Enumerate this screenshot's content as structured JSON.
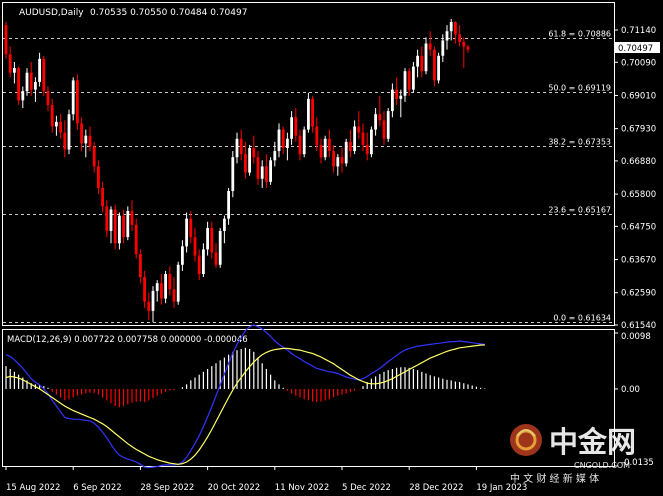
{
  "header": {
    "symbol": "AUDUSD,Daily",
    "ohlc": "0.70535 0.70550 0.70484 0.70497"
  },
  "current_price_label": "0.70497",
  "indicator": {
    "label": "MACD(12,26,9) 0.007722 0.007758 0.000000 -0.000046",
    "axis_ticks": [
      "0.0098",
      "0.00",
      "-0.0135"
    ]
  },
  "watermark": {
    "name": "中金网",
    "domain": "CNGOLD.COM",
    "slogan": "中 文 财 经 新 媒 体"
  },
  "colors": {
    "bull": "#ffffff",
    "bear": "#ff0000",
    "macd_main": "#3333ff",
    "macd_signal": "#ffff66",
    "grid_dash": "#c8c8c8"
  },
  "chart_data": {
    "type": "candlestick",
    "price_axis_ticks": [
      "0.71140",
      "0.70090",
      "0.69010",
      "0.67930",
      "0.66880",
      "0.65800",
      "0.64750",
      "0.63670",
      "0.62590",
      "0.61540"
    ],
    "price_axis_values": [
      0.7114,
      0.7009,
      0.6901,
      0.6793,
      0.6688,
      0.658,
      0.6475,
      0.6367,
      0.6259,
      0.6154
    ],
    "fib_levels": [
      {
        "label": "61.8 = 0.70886",
        "value": 0.70886
      },
      {
        "label": "50.0 = 0.69119",
        "value": 0.69119
      },
      {
        "label": "38.2 = 0.67353",
        "value": 0.67353
      },
      {
        "label": "23.6 = 0.65167",
        "value": 0.65167
      },
      {
        "label": "0.0 = 0.61634",
        "value": 0.61634
      }
    ],
    "x_labels": [
      "15 Aug 2022",
      "6 Sep 2022",
      "28 Sep 2022",
      "20 Oct 2022",
      "11 Nov 2022",
      "5 Dec 2022",
      "28 Dec 2022",
      "19 Jan 2023"
    ],
    "x_label_index": [
      0,
      16,
      32,
      48,
      64,
      80,
      96,
      112
    ],
    "candles": [
      [
        0.713,
        0.714,
        0.702,
        0.7035
      ],
      [
        0.7035,
        0.706,
        0.696,
        0.6975
      ],
      [
        0.6975,
        0.701,
        0.694,
        0.699
      ],
      [
        0.699,
        0.6995,
        0.687,
        0.6885
      ],
      [
        0.6885,
        0.693,
        0.686,
        0.6915
      ],
      [
        0.6915,
        0.699,
        0.69,
        0.6975
      ],
      [
        0.6975,
        0.701,
        0.69,
        0.692
      ],
      [
        0.692,
        0.696,
        0.688,
        0.6945
      ],
      [
        0.6945,
        0.704,
        0.693,
        0.702
      ],
      [
        0.702,
        0.703,
        0.69,
        0.6915
      ],
      [
        0.6915,
        0.693,
        0.685,
        0.687
      ],
      [
        0.687,
        0.689,
        0.678,
        0.68
      ],
      [
        0.68,
        0.6835,
        0.677,
        0.6815
      ],
      [
        0.6815,
        0.684,
        0.676,
        0.678
      ],
      [
        0.678,
        0.682,
        0.67,
        0.6725
      ],
      [
        0.6725,
        0.6855,
        0.671,
        0.684
      ],
      [
        0.684,
        0.696,
        0.682,
        0.695
      ],
      [
        0.695,
        0.697,
        0.679,
        0.681
      ],
      [
        0.681,
        0.683,
        0.672,
        0.6745
      ],
      [
        0.6745,
        0.679,
        0.67,
        0.677
      ],
      [
        0.677,
        0.68,
        0.672,
        0.6735
      ],
      [
        0.6735,
        0.675,
        0.665,
        0.667
      ],
      [
        0.667,
        0.669,
        0.658,
        0.66
      ],
      [
        0.66,
        0.662,
        0.652,
        0.654
      ],
      [
        0.654,
        0.656,
        0.644,
        0.646
      ],
      [
        0.646,
        0.654,
        0.642,
        0.653
      ],
      [
        0.653,
        0.6545,
        0.64,
        0.642
      ],
      [
        0.642,
        0.652,
        0.64,
        0.651
      ],
      [
        0.651,
        0.653,
        0.642,
        0.644
      ],
      [
        0.644,
        0.654,
        0.643,
        0.6525
      ],
      [
        0.6525,
        0.656,
        0.646,
        0.648
      ],
      [
        0.648,
        0.65,
        0.637,
        0.6385
      ],
      [
        0.6385,
        0.64,
        0.629,
        0.631
      ],
      [
        0.631,
        0.633,
        0.621,
        0.623
      ],
      [
        0.623,
        0.626,
        0.617,
        0.62
      ],
      [
        0.62,
        0.628,
        0.6163,
        0.6265
      ],
      [
        0.6265,
        0.63,
        0.623,
        0.629
      ],
      [
        0.629,
        0.632,
        0.622,
        0.624
      ],
      [
        0.624,
        0.633,
        0.6225,
        0.632
      ],
      [
        0.632,
        0.6345,
        0.625,
        0.627
      ],
      [
        0.627,
        0.631,
        0.621,
        0.623
      ],
      [
        0.623,
        0.636,
        0.622,
        0.635
      ],
      [
        0.635,
        0.643,
        0.633,
        0.641
      ],
      [
        0.641,
        0.652,
        0.639,
        0.65
      ],
      [
        0.65,
        0.6525,
        0.642,
        0.644
      ],
      [
        0.644,
        0.647,
        0.636,
        0.638
      ],
      [
        0.638,
        0.64,
        0.63,
        0.632
      ],
      [
        0.632,
        0.642,
        0.631,
        0.64
      ],
      [
        0.64,
        0.649,
        0.638,
        0.647
      ],
      [
        0.647,
        0.649,
        0.637,
        0.639
      ],
      [
        0.639,
        0.642,
        0.634,
        0.635
      ],
      [
        0.635,
        0.647,
        0.634,
        0.646
      ],
      [
        0.646,
        0.651,
        0.642,
        0.65
      ],
      [
        0.65,
        0.66,
        0.648,
        0.659
      ],
      [
        0.659,
        0.672,
        0.657,
        0.67
      ],
      [
        0.67,
        0.678,
        0.668,
        0.676
      ],
      [
        0.676,
        0.679,
        0.669,
        0.671
      ],
      [
        0.671,
        0.675,
        0.663,
        0.665
      ],
      [
        0.665,
        0.674,
        0.664,
        0.673
      ],
      [
        0.673,
        0.677,
        0.668,
        0.67
      ],
      [
        0.67,
        0.672,
        0.661,
        0.663
      ],
      [
        0.663,
        0.669,
        0.66,
        0.667
      ],
      [
        0.667,
        0.671,
        0.66,
        0.662
      ],
      [
        0.662,
        0.67,
        0.661,
        0.669
      ],
      [
        0.669,
        0.675,
        0.667,
        0.672
      ],
      [
        0.672,
        0.681,
        0.67,
        0.679
      ],
      [
        0.679,
        0.68,
        0.671,
        0.673
      ],
      [
        0.673,
        0.678,
        0.669,
        0.676
      ],
      [
        0.676,
        0.685,
        0.674,
        0.683
      ],
      [
        0.683,
        0.686,
        0.675,
        0.677
      ],
      [
        0.677,
        0.679,
        0.669,
        0.671
      ],
      [
        0.671,
        0.68,
        0.67,
        0.679
      ],
      [
        0.679,
        0.691,
        0.678,
        0.689
      ],
      [
        0.689,
        0.69,
        0.678,
        0.68
      ],
      [
        0.68,
        0.683,
        0.672,
        0.674
      ],
      [
        0.674,
        0.676,
        0.668,
        0.67
      ],
      [
        0.67,
        0.677,
        0.669,
        0.676
      ],
      [
        0.676,
        0.679,
        0.67,
        0.672
      ],
      [
        0.672,
        0.674,
        0.665,
        0.667
      ],
      [
        0.667,
        0.671,
        0.664,
        0.67
      ],
      [
        0.67,
        0.673,
        0.665,
        0.668
      ],
      [
        0.668,
        0.676,
        0.667,
        0.675
      ],
      [
        0.675,
        0.679,
        0.67,
        0.672
      ],
      [
        0.672,
        0.682,
        0.671,
        0.68
      ],
      [
        0.68,
        0.685,
        0.676,
        0.678
      ],
      [
        0.678,
        0.681,
        0.672,
        0.674
      ],
      [
        0.674,
        0.678,
        0.669,
        0.671
      ],
      [
        0.671,
        0.68,
        0.67,
        0.679
      ],
      [
        0.679,
        0.686,
        0.677,
        0.684
      ],
      [
        0.684,
        0.69,
        0.68,
        0.682
      ],
      [
        0.682,
        0.685,
        0.674,
        0.676
      ],
      [
        0.676,
        0.686,
        0.675,
        0.685
      ],
      [
        0.685,
        0.694,
        0.683,
        0.692
      ],
      [
        0.692,
        0.696,
        0.687,
        0.689
      ],
      [
        0.689,
        0.692,
        0.683,
        0.69
      ],
      [
        0.69,
        0.699,
        0.688,
        0.698
      ],
      [
        0.698,
        0.699,
        0.69,
        0.692
      ],
      [
        0.692,
        0.701,
        0.691,
        0.6995
      ],
      [
        0.6995,
        0.705,
        0.696,
        0.703
      ],
      [
        0.703,
        0.706,
        0.696,
        0.698
      ],
      [
        0.698,
        0.709,
        0.697,
        0.707
      ],
      [
        0.707,
        0.711,
        0.703,
        0.705
      ],
      [
        0.705,
        0.706,
        0.693,
        0.695
      ],
      [
        0.695,
        0.704,
        0.694,
        0.703
      ],
      [
        0.703,
        0.71,
        0.701,
        0.708
      ],
      [
        0.708,
        0.713,
        0.705,
        0.711
      ],
      [
        0.711,
        0.715,
        0.708,
        0.714
      ],
      [
        0.714,
        0.7142,
        0.707,
        0.71
      ],
      [
        0.71,
        0.713,
        0.706,
        0.7075
      ],
      [
        0.7075,
        0.709,
        0.699,
        0.706
      ],
      [
        0.706,
        0.7065,
        0.704,
        0.705
      ]
    ],
    "macd": {
      "ylim": [
        -0.0135,
        0.0098
      ],
      "histogram": [
        0.004,
        0.0035,
        0.003,
        0.0025,
        0.002,
        0.0015,
        0.001,
        0.0008,
        0.0007,
        0.0005,
        0.0002,
        -0.0005,
        -0.001,
        -0.0015,
        -0.002,
        -0.0018,
        -0.0015,
        -0.0012,
        -0.001,
        -0.0008,
        -0.0006,
        -0.0007,
        -0.001,
        -0.0015,
        -0.002,
        -0.0025,
        -0.003,
        -0.0032,
        -0.003,
        -0.0027,
        -0.0024,
        -0.0022,
        -0.0022,
        -0.0023,
        -0.002,
        -0.0016,
        -0.0012,
        -0.0008,
        -0.0005,
        -0.0003,
        -0.0002,
        0.0,
        0.0003,
        0.0008,
        0.0015,
        0.002,
        0.0025,
        0.003,
        0.0035,
        0.004,
        0.0045,
        0.005,
        0.0055,
        0.006,
        0.0065,
        0.0068,
        0.007,
        0.0072,
        0.007,
        0.0065,
        0.0055,
        0.0045,
        0.0035,
        0.0025,
        0.0015,
        0.0008,
        0.0002,
        -0.0003,
        -0.0008,
        -0.0012,
        -0.0015,
        -0.0018,
        -0.002,
        -0.0022,
        -0.0023,
        -0.0022,
        -0.002,
        -0.0018,
        -0.0015,
        -0.0012,
        -0.001,
        -0.0008,
        -0.0005,
        -0.0003,
        0.0,
        0.0005,
        0.0012,
        0.0018,
        0.0022,
        0.0026,
        0.003,
        0.0033,
        0.0035,
        0.0037,
        0.0038,
        0.0038,
        0.0037,
        0.0035,
        0.0033,
        0.003,
        0.0027,
        0.0024,
        0.0022,
        0.002,
        0.0018,
        0.0016,
        0.0015,
        0.0013,
        0.0012,
        0.001,
        0.0008,
        0.0006,
        0.0004,
        0.0002,
        0.0001
      ],
      "signal": [
        0.002,
        0.0022,
        0.0021,
        0.0019,
        0.0016,
        0.0012,
        0.0008,
        0.0004,
        0.0,
        -0.0005,
        -0.001,
        -0.0015,
        -0.002,
        -0.0025,
        -0.003,
        -0.0034,
        -0.0038,
        -0.0041,
        -0.0044,
        -0.0047,
        -0.005,
        -0.0053,
        -0.0057,
        -0.0061,
        -0.0066,
        -0.0072,
        -0.0078,
        -0.0084,
        -0.009,
        -0.0096,
        -0.0101,
        -0.0106,
        -0.011,
        -0.0114,
        -0.0118,
        -0.0121,
        -0.0124,
        -0.0126,
        -0.0128,
        -0.013,
        -0.0131,
        -0.0132,
        -0.0131,
        -0.0128,
        -0.0123,
        -0.0116,
        -0.0107,
        -0.0096,
        -0.0084,
        -0.0071,
        -0.0057,
        -0.0043,
        -0.0029,
        -0.0015,
        -0.0002,
        0.001,
        0.002,
        0.003,
        0.0039,
        0.0047,
        0.0054,
        0.006,
        0.0064,
        0.0067,
        0.0069,
        0.007,
        0.0071,
        0.0071,
        0.007,
        0.0069,
        0.0068,
        0.0066,
        0.0064,
        0.0062,
        0.0059,
        0.0056,
        0.0052,
        0.0048,
        0.0044,
        0.0039,
        0.0034,
        0.0029,
        0.0024,
        0.002,
        0.0016,
        0.0013,
        0.001,
        0.0009,
        0.0009,
        0.001,
        0.0012,
        0.0015,
        0.0018,
        0.0022,
        0.0026,
        0.003,
        0.0034,
        0.0038,
        0.0042,
        0.0046,
        0.005,
        0.0054,
        0.0057,
        0.006,
        0.0063,
        0.0066,
        0.0068,
        0.007,
        0.0072,
        0.0073,
        0.0074,
        0.0075,
        0.0076,
        0.0077,
        0.0077
      ]
    }
  }
}
